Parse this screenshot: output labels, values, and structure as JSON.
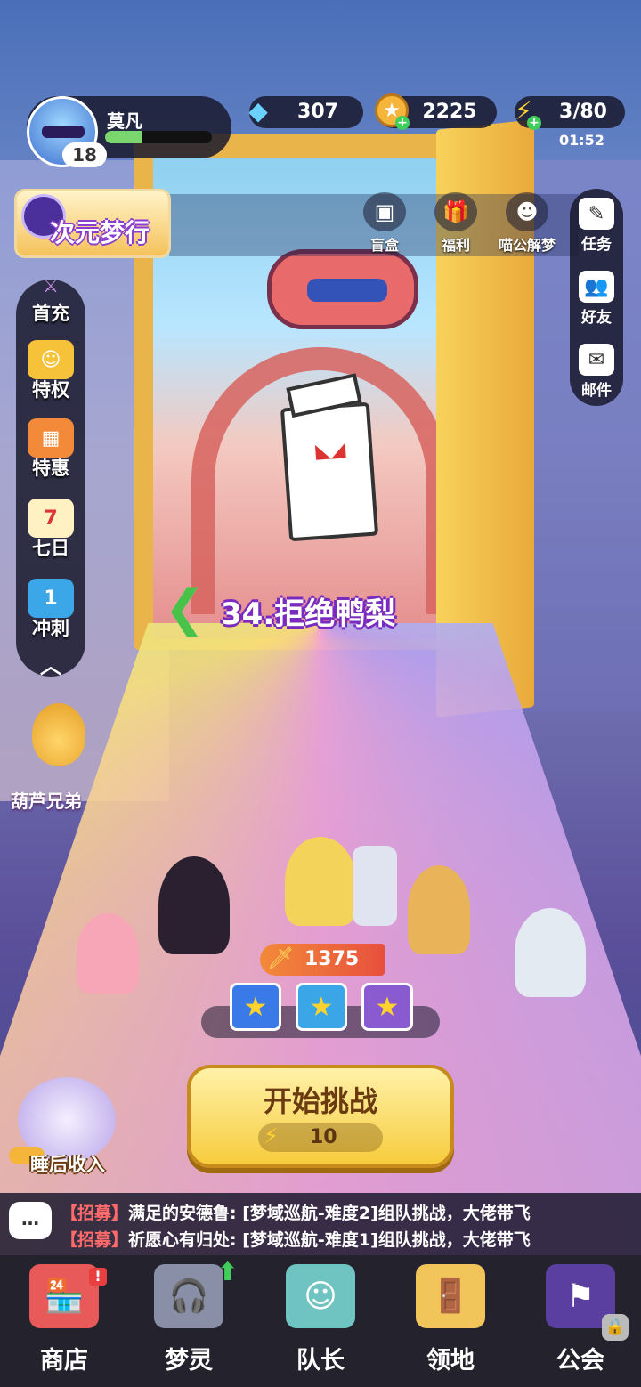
{
  "player": {
    "name": "莫凡",
    "level": "18",
    "xp_fraction": 0.35
  },
  "resources": {
    "gems": "307",
    "coins": "2225",
    "energy": "3/80",
    "energy_timer": "01:52"
  },
  "event": {
    "label": "次元梦行"
  },
  "top_buttons": [
    {
      "label": "盲盒",
      "icon": "blindbox-icon"
    },
    {
      "label": "福利",
      "icon": "gift-icon"
    },
    {
      "label": "喵公解梦",
      "icon": "cat-icon"
    }
  ],
  "right_menu": [
    {
      "label": "任务",
      "icon": "task-icon"
    },
    {
      "label": "好友",
      "icon": "friends-icon"
    },
    {
      "label": "邮件",
      "icon": "mail-icon"
    }
  ],
  "left_menu": [
    {
      "label": "首充",
      "icon": "first-recharge-icon"
    },
    {
      "label": "特权",
      "icon": "privilege-icon"
    },
    {
      "label": "特惠",
      "icon": "deal-icon"
    },
    {
      "label": "七日",
      "icon": "calendar-icon",
      "icon_text": "7"
    },
    {
      "label": "冲刺",
      "icon": "sprint-icon",
      "icon_text": "1"
    }
  ],
  "gourd": {
    "label": "葫芦兄弟"
  },
  "stage": {
    "name": "34.拒绝鸭梨"
  },
  "team": {
    "power": "1375"
  },
  "start": {
    "label": "开始挑战",
    "cost": "10"
  },
  "sleep": {
    "label": "睡后收入"
  },
  "chat": {
    "lines": [
      {
        "tag": "【招募】",
        "text": "满足的安德鲁: [梦域巡航-难度2]组队挑战，大佬带飞"
      },
      {
        "tag": "【招募】",
        "text": "祈愿心有归处: [梦域巡航-难度1]组队挑战，大佬带飞"
      }
    ]
  },
  "nav": [
    {
      "label": "商店",
      "icon": "shop-icon"
    },
    {
      "label": "梦灵",
      "icon": "spirit-icon"
    },
    {
      "label": "队长",
      "icon": "captain-icon"
    },
    {
      "label": "领地",
      "icon": "territory-icon"
    },
    {
      "label": "公会",
      "icon": "guild-icon"
    }
  ],
  "colors": {
    "accent_purple": "#7a2bbf",
    "start_yellow": "#f7cc3d",
    "nav_bg": "#23222d"
  }
}
